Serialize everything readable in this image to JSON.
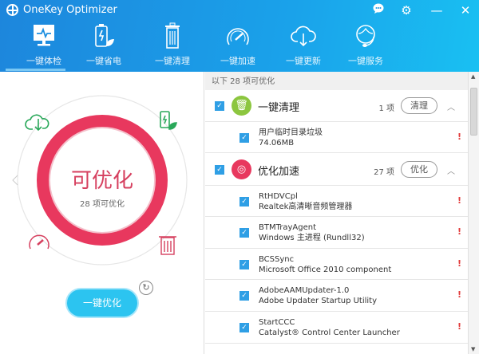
{
  "app": {
    "title": "OneKey Optimizer"
  },
  "window": {
    "chat_icon": "chat-icon",
    "settings_icon": "gear-icon",
    "minimize": "—",
    "close": "✕"
  },
  "tabs": [
    {
      "label": "一键体检",
      "active": true
    },
    {
      "label": "一键省电"
    },
    {
      "label": "一键清理"
    },
    {
      "label": "一键加速"
    },
    {
      "label": "一键更新"
    },
    {
      "label": "一键服务"
    }
  ],
  "status": {
    "title": "可优化",
    "subtitle": "28 项可优化",
    "accent": "#e8385e"
  },
  "optimize_button": "一键优化",
  "list": {
    "header": "以下 28 项可优化",
    "groups": [
      {
        "name": "一键清理",
        "count": "1 项",
        "button": "清理",
        "color": "#8cc63f",
        "items": [
          {
            "name": "用户临时目录垃圾",
            "desc": "74.06MB"
          }
        ]
      },
      {
        "name": "优化加速",
        "count": "27 项",
        "button": "优化",
        "color": "#e8385e",
        "items": [
          {
            "name": "RtHDVCpl",
            "desc": "Realtek高清晰音频管理器"
          },
          {
            "name": "BTMTrayAgent",
            "desc": "Windows 主进程 (Rundll32)"
          },
          {
            "name": "BCSSync",
            "desc": "Microsoft Office 2010 component"
          },
          {
            "name": "AdobeAAMUpdater-1.0",
            "desc": "Adobe Updater Startup Utility"
          },
          {
            "name": "StartCCC",
            "desc": "Catalyst® Control Center Launcher"
          }
        ]
      }
    ]
  }
}
